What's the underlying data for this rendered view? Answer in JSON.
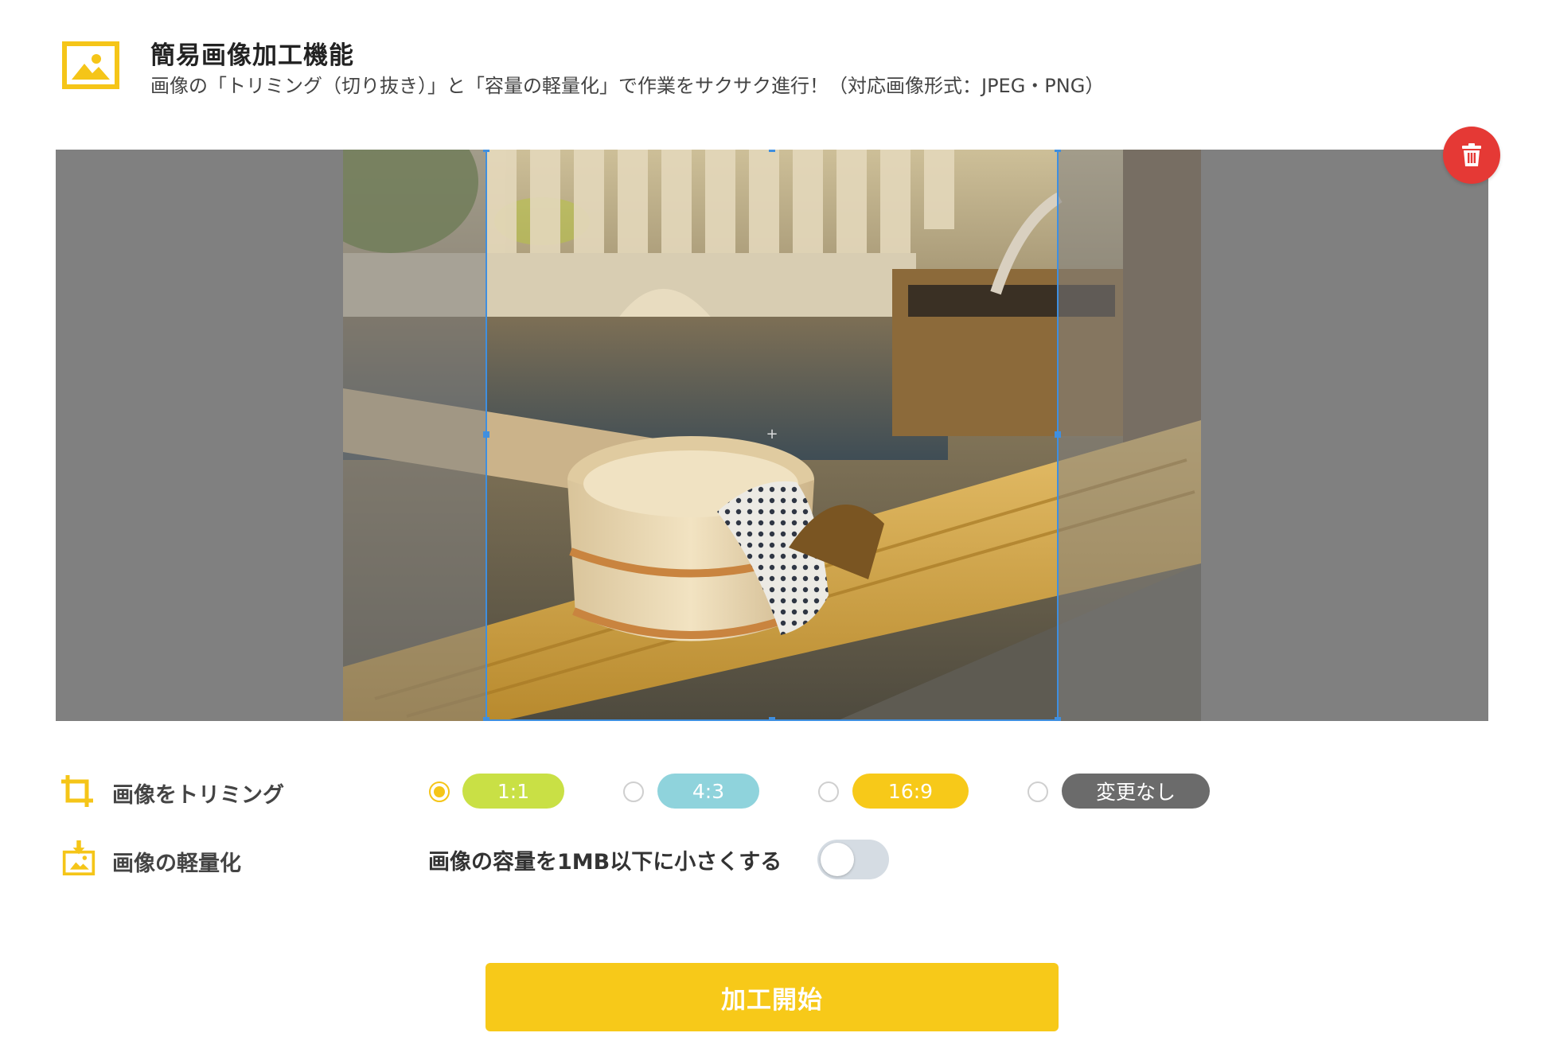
{
  "header": {
    "title": "簡易画像加工機能",
    "subtitle": "画像の「トリミング（切り抜き）」と「容量の軽量化」で作業をサクサク進行！（対応画像形式：JPEG・PNG）",
    "icon": "image-icon"
  },
  "editor": {
    "delete_icon": "trash-icon",
    "crop_ratio": "1:1"
  },
  "trim": {
    "label": "画像をトリミング",
    "icon": "crop-icon",
    "options": [
      {
        "label": "1:1",
        "color": "#c9e045",
        "selected": true
      },
      {
        "label": "4:3",
        "color": "#8fd3dc",
        "selected": false
      },
      {
        "label": "16:9",
        "color": "#f7c919",
        "selected": false
      },
      {
        "label": "変更なし",
        "color": "#6b6b6b",
        "selected": false
      }
    ]
  },
  "compress": {
    "label": "画像の軽量化",
    "icon": "image-download-icon",
    "toggle_label": "画像の容量を1MB以下に小さくする",
    "enabled": false
  },
  "start_button": {
    "label": "加工開始",
    "color": "#f7c919"
  },
  "colors": {
    "accent": "#f5c518",
    "delete": "#e53935",
    "crop_border": "#3f8fe0"
  }
}
